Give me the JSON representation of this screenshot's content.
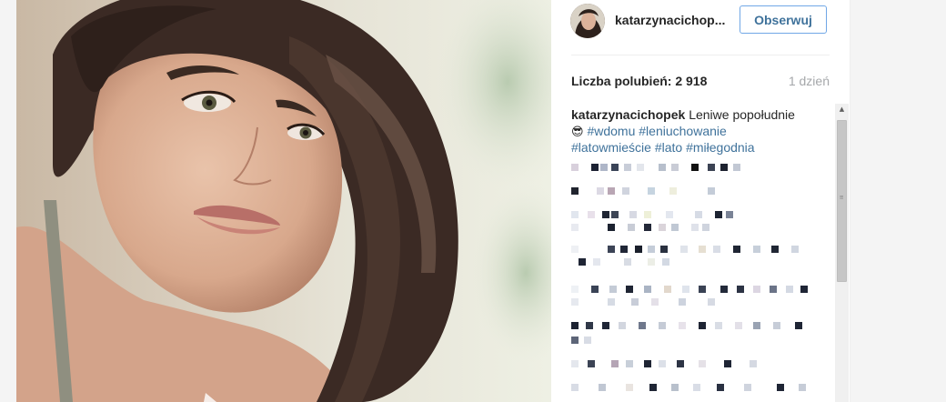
{
  "post": {
    "username": "katarzynacichop...",
    "follow_label": "Obserwuj",
    "likes_label": "Liczba polubień:",
    "likes_count": "2 918",
    "time_ago": "1 dzień"
  },
  "caption": {
    "username": "katarzynacichopek",
    "text": "Leniwe popołudnie",
    "emoji": "😎",
    "hashtags": [
      "#wdomu",
      "#leniuchowanie",
      "#latowmieście",
      "#lato",
      "#miłegodnia"
    ]
  },
  "icons": {
    "avatar": "profile-avatar",
    "scroll_up": "scroll-up-arrow-icon",
    "scroll_grip": "scroll-grip-icon"
  },
  "colors": {
    "link": "#3f729b",
    "follow_border": "#70a7e6",
    "muted": "#a5a7aa"
  }
}
